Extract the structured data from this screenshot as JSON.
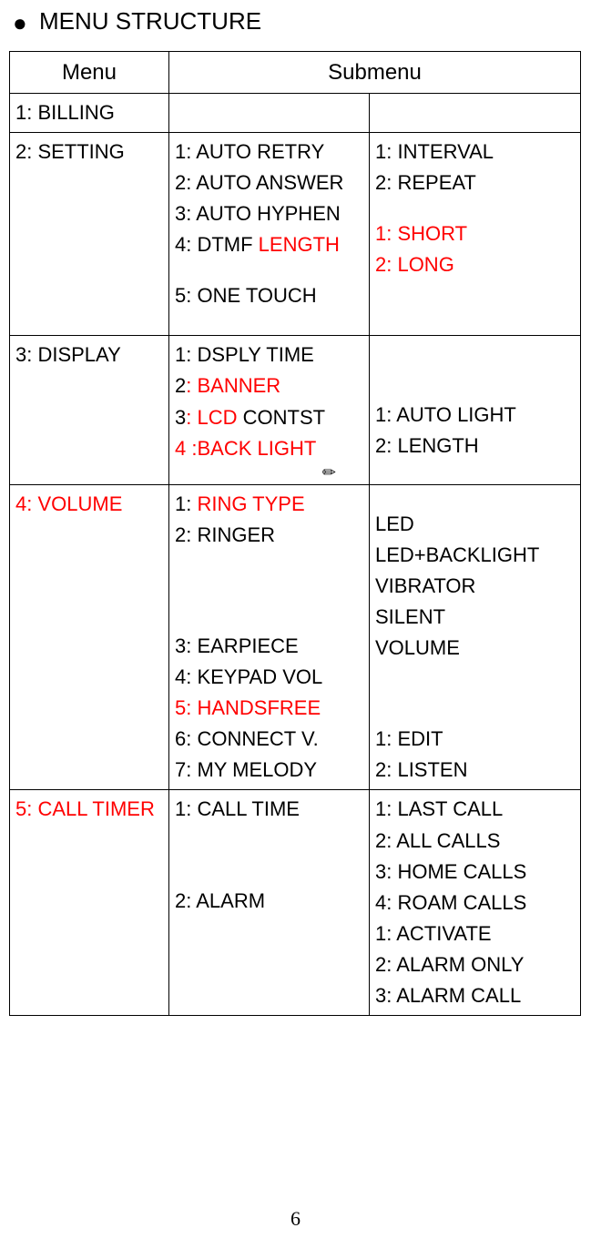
{
  "title": "MENU STRUCTURE",
  "headers": {
    "menu": "Menu",
    "submenu": "Submenu"
  },
  "rows": {
    "r1": {
      "menu": "1: BILLING"
    },
    "r2": {
      "menu": "2: SETTING",
      "sub": {
        "s1": "1: AUTO RETRY",
        "s2": "2: AUTO ANSWER",
        "s3": "3: AUTO HYPHEN",
        "s4a": "4: DTMF ",
        "s4b": "LENGTH",
        "s5": "5: ONE TOUCH"
      },
      "opt": {
        "o1": "1: INTERVAL",
        "o2": "2: REPEAT",
        "o3": "1: SHORT",
        "o4": "2: LONG"
      }
    },
    "r3": {
      "menu": "3: DISPLAY",
      "sub": {
        "s1": "1: DSPLY TIME",
        "s2a": "2",
        "s2b": ": BANNER",
        "s3a": "3",
        "s3b": ": LCD",
        "s3c": " CONTST",
        "s4a": "4 :",
        "s4b": "BACK LIGHT"
      },
      "opt": {
        "o1": "1: AUTO LIGHT",
        "o2": "2: LENGTH"
      }
    },
    "r4": {
      "menua": "4",
      "menub": ": VOLUME",
      "sub": {
        "s1a": "1: ",
        "s1b": "RING TYPE",
        "s2": "2: RINGER",
        "s3": "3: EARPIECE",
        "s4": "4: KEYPAD VOL",
        "s5": "5: HANDSFREE",
        "s6": "6: CONNECT V.",
        "s7": "7: MY MELODY"
      },
      "opt": {
        "o1": "LED",
        "o2": "LED+BACKLIGHT",
        "o3": "VIBRATOR",
        "o4": "SILENT",
        "o5": "VOLUME",
        "o6": "1: EDIT",
        "o7": "2: LISTEN"
      }
    },
    "r5": {
      "menu": "5: CALL TIMER",
      "sub": {
        "s1": "1: CALL TIME",
        "s2": "2: ALARM"
      },
      "opt": {
        "o1": "1: LAST CALL",
        "o2": "2: ALL CALLS",
        "o3": "3: HOME CALLS",
        "o4": "4: ROAM CALLS",
        "o5": "1: ACTIVATE",
        "o6": "2: ALARM ONLY",
        "o7": "3: ALARM CALL"
      }
    }
  },
  "page_number": "6"
}
